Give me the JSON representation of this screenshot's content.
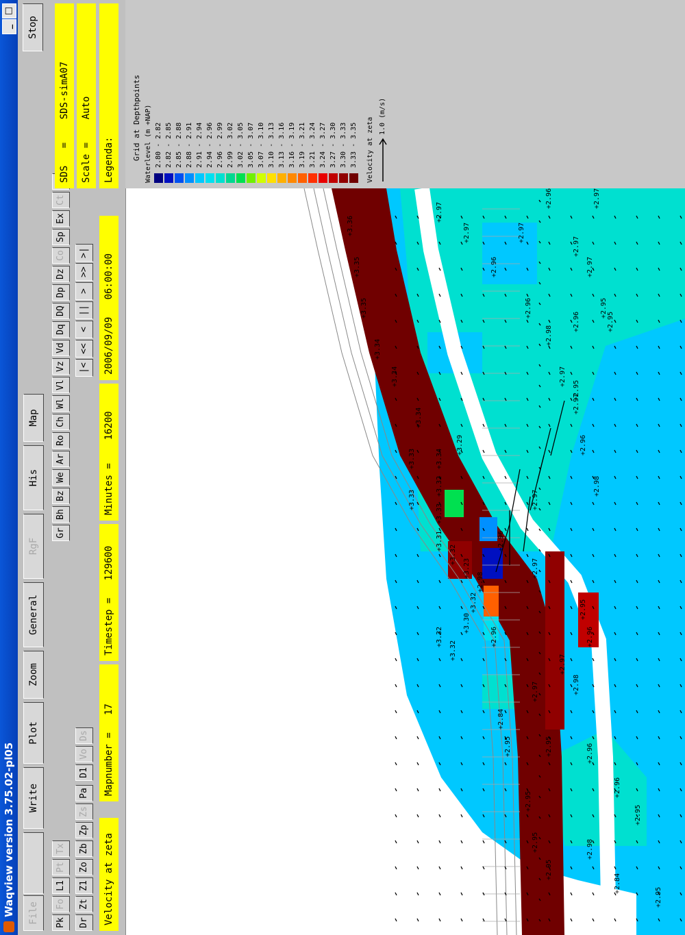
{
  "window": {
    "title": "Waqview version 3.75.02-pl05",
    "min": "_",
    "max": "□"
  },
  "menu": {
    "row1": [
      {
        "label": "File",
        "enabled": false
      },
      {
        "label": "",
        "enabled": false
      },
      {
        "label": "Write",
        "enabled": true
      },
      {
        "label": "Plot",
        "enabled": true
      },
      {
        "label": "Zoom",
        "enabled": true
      },
      {
        "label": "General",
        "enabled": true
      },
      {
        "label": "RgF",
        "enabled": false
      },
      {
        "label": "His",
        "enabled": true
      },
      {
        "label": "Map",
        "enabled": true
      }
    ],
    "stop": "Stop"
  },
  "toolbar": {
    "row2": [
      {
        "label": "Pk",
        "enabled": true
      },
      {
        "label": "Fo",
        "enabled": false
      },
      {
        "label": "L1",
        "enabled": true
      },
      {
        "label": "Pt",
        "enabled": false
      },
      {
        "label": "Tx",
        "enabled": false
      }
    ],
    "row2b": [
      {
        "label": "Gr",
        "enabled": true
      },
      {
        "label": "Bh",
        "enabled": true
      },
      {
        "label": "Bz",
        "enabled": true
      },
      {
        "label": "We",
        "enabled": true
      },
      {
        "label": "Ar",
        "enabled": true
      },
      {
        "label": "Ro",
        "enabled": true
      },
      {
        "label": "Ch",
        "enabled": true
      },
      {
        "label": "Wl",
        "enabled": true
      },
      {
        "label": "Vl",
        "enabled": true
      },
      {
        "label": "Vz",
        "enabled": true
      },
      {
        "label": "Vd",
        "enabled": true
      },
      {
        "label": "Dq",
        "enabled": true
      },
      {
        "label": "DQ",
        "enabled": true
      },
      {
        "label": "Dp",
        "enabled": true
      },
      {
        "label": "Dz",
        "enabled": true
      },
      {
        "label": "Co",
        "enabled": false
      },
      {
        "label": "Sp",
        "enabled": true
      },
      {
        "label": "Ex",
        "enabled": true
      },
      {
        "label": "Ct",
        "enabled": false
      },
      {
        "label": "Wv",
        "enabled": false
      }
    ],
    "row3": [
      {
        "label": "Dr",
        "enabled": true
      },
      {
        "label": "Zt",
        "enabled": true
      },
      {
        "label": "Z1",
        "enabled": true
      },
      {
        "label": "Zo",
        "enabled": true
      },
      {
        "label": "Zb",
        "enabled": true
      },
      {
        "label": "Zp",
        "enabled": true
      },
      {
        "label": "Zs",
        "enabled": false
      },
      {
        "label": "Pa",
        "enabled": true
      },
      {
        "label": "D1",
        "enabled": true
      },
      {
        "label": "Vo",
        "enabled": false
      },
      {
        "label": "Ds",
        "enabled": false
      }
    ],
    "nav": [
      "|<",
      "<<",
      "<",
      "||",
      ">",
      ">>",
      ">|"
    ]
  },
  "status": {
    "quantity": "Velocity at zeta",
    "mapnumber": "Mapnumber =   17",
    "timestep": "Timestep =   129600",
    "minutes": "Minutes =    16200",
    "datetime": "2006/09/09   06:00:00",
    "sds": "SDS   =    SDS-simA07",
    "scale": "Scale =    Auto",
    "legenda": "Legenda:"
  },
  "legend": {
    "title": "Grid at Depthpoints",
    "header": "Waterlevel (m +NAP)",
    "classes": [
      {
        "label": "2.80 - 2.82",
        "color": "#000080"
      },
      {
        "label": "2.82 - 2.85",
        "color": "#0010c0"
      },
      {
        "label": "2.85 - 2.88",
        "color": "#0050f0"
      },
      {
        "label": "2.88 - 2.91",
        "color": "#0090ff"
      },
      {
        "label": "2.91 - 2.94",
        "color": "#00c8ff"
      },
      {
        "label": "2.94 - 2.96",
        "color": "#00e0f0"
      },
      {
        "label": "2.96 - 2.99",
        "color": "#00e0d0"
      },
      {
        "label": "2.99 - 3.02",
        "color": "#00d890"
      },
      {
        "label": "3.02 - 3.05",
        "color": "#00e050"
      },
      {
        "label": "3.05 - 3.07",
        "color": "#70f000"
      },
      {
        "label": "3.07 - 3.10",
        "color": "#d0ff00"
      },
      {
        "label": "3.10 - 3.13",
        "color": "#ffe000"
      },
      {
        "label": "3.13 - 3.16",
        "color": "#ffb000"
      },
      {
        "label": "3.16 - 3.19",
        "color": "#ff8800"
      },
      {
        "label": "3.19 - 3.21",
        "color": "#ff6000"
      },
      {
        "label": "3.21 - 3.24",
        "color": "#ff3000"
      },
      {
        "label": "3.24 - 3.27",
        "color": "#e80000"
      },
      {
        "label": "3.27 - 3.30",
        "color": "#c00000"
      },
      {
        "label": "3.30 - 3.33",
        "color": "#900000"
      },
      {
        "label": "3.33 - 3.35",
        "color": "#700000"
      }
    ],
    "velocity_title": "Velocity at zeta",
    "velocity_scale": "1.0 (m/s)"
  },
  "map_labels": [
    "+2.95",
    "+2.84",
    "+2.98",
    "+2.95",
    "+2.96",
    "+2.96",
    "+2.98",
    "+2.95",
    "+2.95",
    "+2.84",
    "+2.96",
    "+2.98",
    "+2.95",
    "+3.23",
    "+3.29",
    "+3.31",
    "+3.32",
    "+3.30",
    "+3.32",
    "+3.32",
    "+3.32",
    "+3.33",
    "+3.32",
    "+2.95",
    "+2.95",
    "+2.96",
    "+2.97",
    "+2.98",
    "+2.96",
    "+2.97",
    "+2.98",
    "+2.96",
    "+2.96",
    "+2.97",
    "+2.97",
    "+2.95",
    "+2.95",
    "+2.97",
    "+2.97",
    "+2.96",
    "+2.97",
    "+3.34",
    "+3.34",
    "+3.34",
    "+3.34",
    "+3.35",
    "+3.35",
    "+3.36",
    "+2.97",
    "+2.95",
    "+2.96",
    "+2.97",
    "+2.97",
    "+2.96",
    "+2.97",
    "+2.97",
    "+2.95",
    "+3.33",
    "+3.33"
  ]
}
